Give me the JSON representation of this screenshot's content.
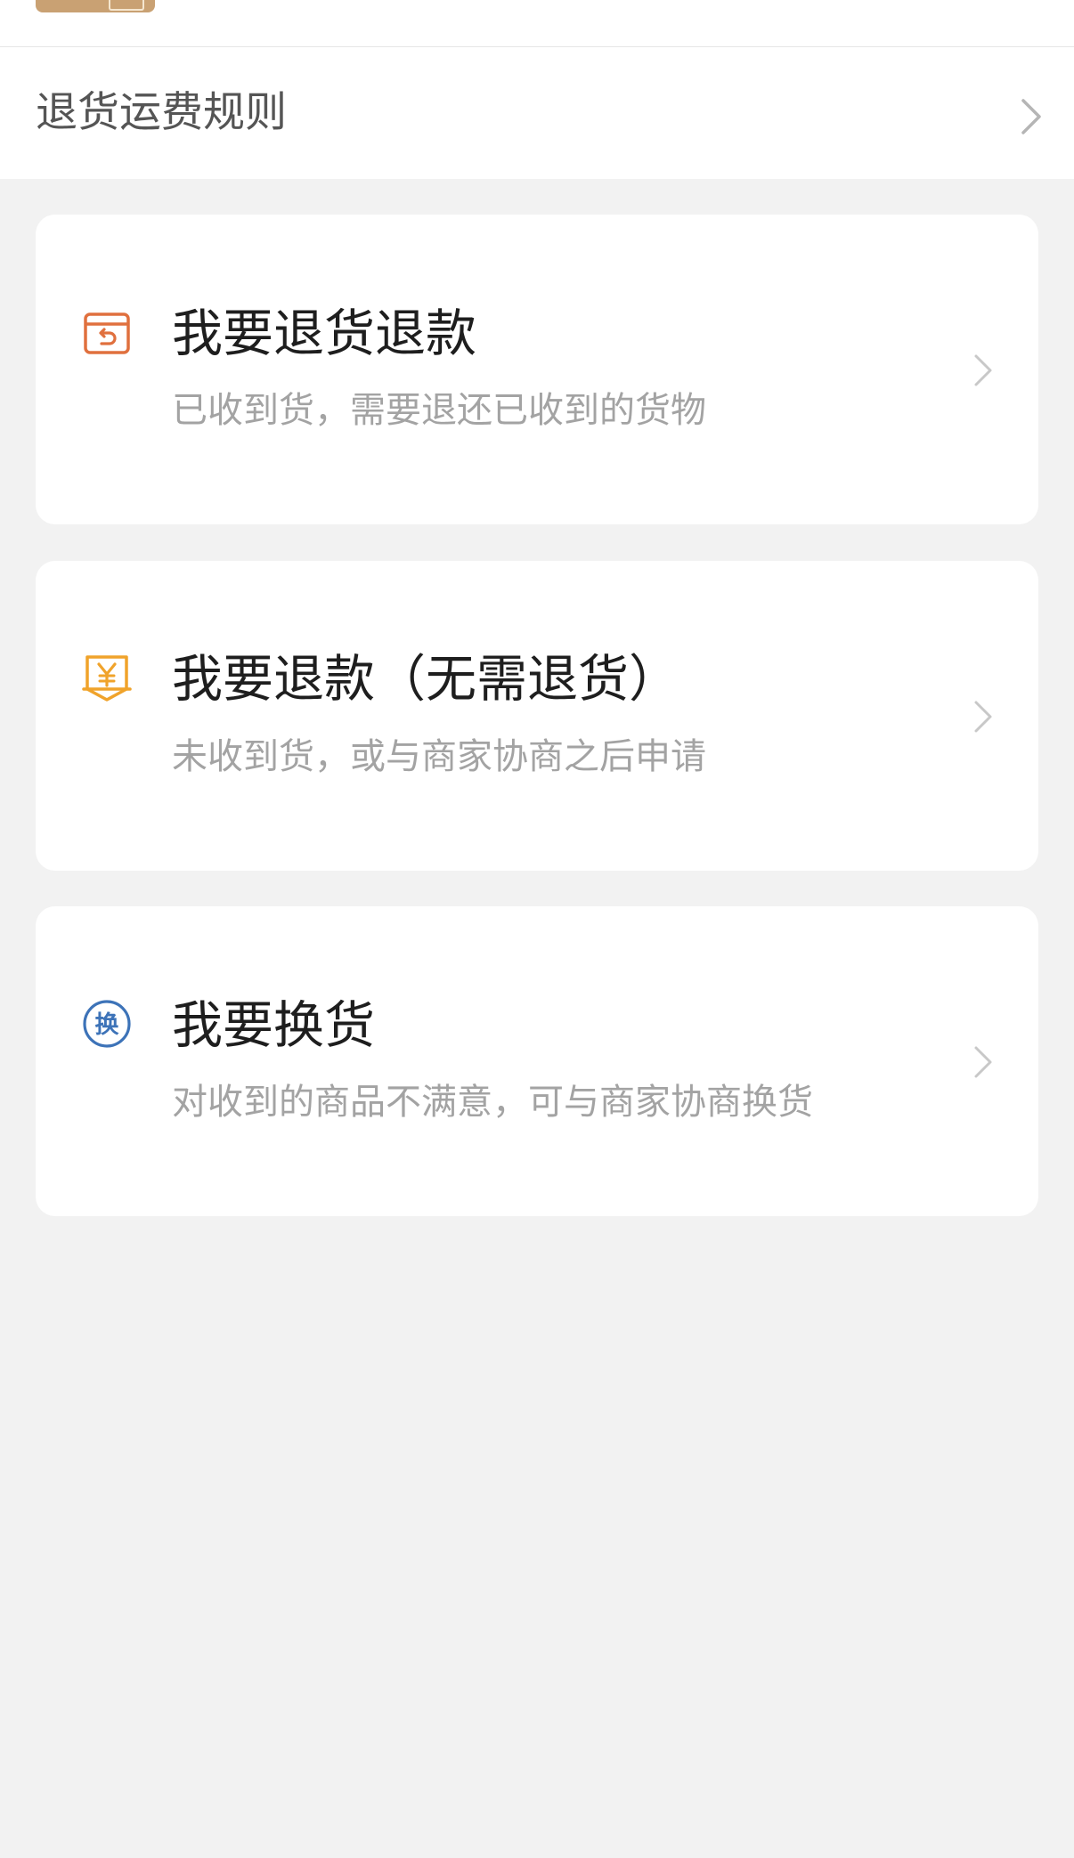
{
  "header": {
    "return_shipping_rules_label": "退货运费规则"
  },
  "options": [
    {
      "icon": "return-box-icon",
      "title": "我要退货退款",
      "subtitle": "已收到货，需要退还已收到的货物",
      "icon_color": "#e0703e"
    },
    {
      "icon": "yen-receipt-icon",
      "title": "我要退款（无需退货）",
      "subtitle": "未收到货，或与商家协商之后申请",
      "icon_color": "#f0a32b"
    },
    {
      "icon": "exchange-icon",
      "title": "我要换货",
      "subtitle": "对收到的商品不满意，可与商家协商换货",
      "icon_color": "#3d73b8",
      "icon_text": "换"
    }
  ]
}
